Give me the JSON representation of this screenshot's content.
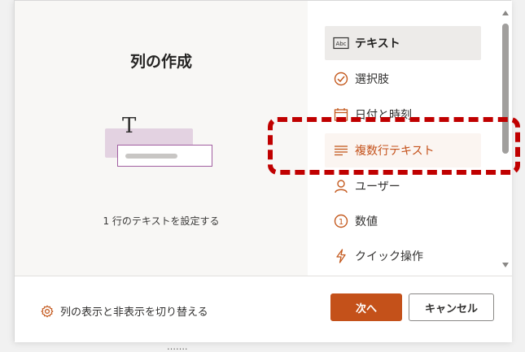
{
  "dialog": {
    "title": "列の作成",
    "preview_description": "1 行のテキストを設定する",
    "preview_letter": "T"
  },
  "column_types": [
    {
      "label": "テキスト",
      "icon": "text-abc-icon",
      "state": "selected"
    },
    {
      "label": "選択肢",
      "icon": "check-circle-icon",
      "state": "normal"
    },
    {
      "label": "日付と時刻",
      "icon": "calendar-icon",
      "state": "normal"
    },
    {
      "label": "複数行テキスト",
      "icon": "multiline-text-icon",
      "state": "hover"
    },
    {
      "label": "ユーザー",
      "icon": "person-icon",
      "state": "normal"
    },
    {
      "label": "数値",
      "icon": "number-circle-icon",
      "state": "normal",
      "icon_text": "1"
    },
    {
      "label": "クイック操作",
      "icon": "flash-icon",
      "state": "normal"
    }
  ],
  "footer": {
    "toggle_label": "列の表示と非表示を切り替える",
    "next_button": "次へ",
    "cancel_button": "キャンセル"
  },
  "background_text": "…….",
  "colors": {
    "accent": "#c4511a",
    "selected_bg": "#edebe9",
    "hover_bg": "#fbf5f1",
    "annotation": "#c00000",
    "illustration_card": "#e3d2e1",
    "illustration_border": "#a15ea0"
  }
}
